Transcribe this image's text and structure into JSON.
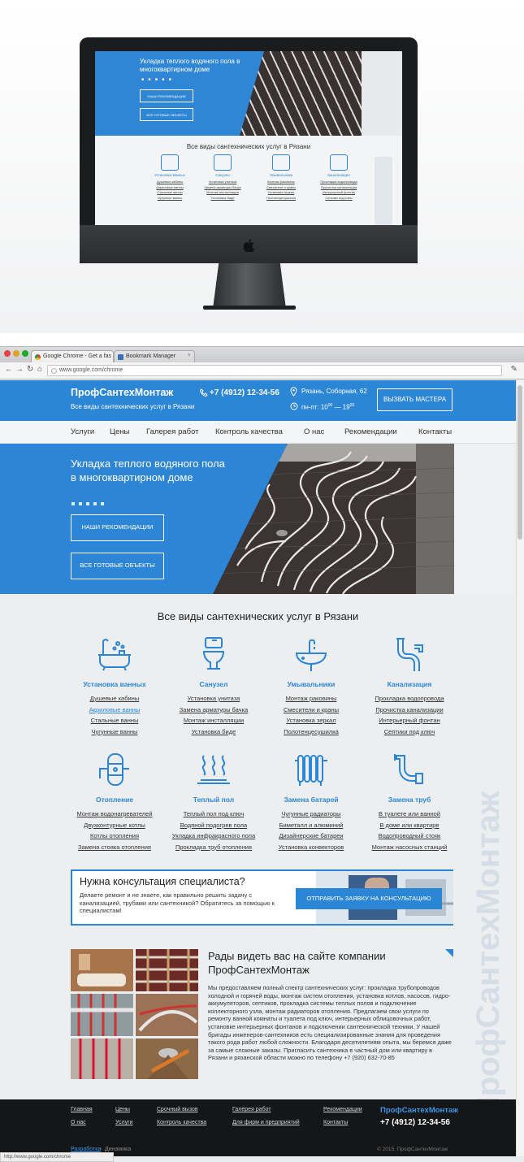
{
  "browser": {
    "tabs": [
      {
        "label": "Google Chrome - Get a fas"
      },
      {
        "label": "Bookmark Manager"
      }
    ],
    "url": "www.google.com/chrome",
    "status_url": "http://www.google.com/chrome"
  },
  "site": {
    "logo": "ПрофСантехМонтаж",
    "tagline": "Все виды сантехнических услуг в Рязани",
    "phone": "+7 (4912) 12-34-56",
    "address": "Рязань, Соборная, 62",
    "hours_prefix": "пн-пт: 10",
    "hours_sup1": "00",
    "hours_mid": " — 19",
    "hours_sup2": "00",
    "call_button": "ВЫЗВАТЬ МАСТЕРА",
    "nav": [
      "Услуги",
      "Цены",
      "Галерея работ",
      "Контроль качества",
      "О нас",
      "Рекомендации",
      "Контакты"
    ],
    "hero": {
      "title": "Укладка теплого водяного пола в многоквартирном доме",
      "button1": "НАШИ РЕКОМЕНДАЦИИ",
      "button2": "ВСЕ ГОТОВЫЕ ОБЪЕКТЫ"
    },
    "services_title": "Все виды сантехнических услуг в Рязани",
    "services": [
      {
        "name": "Установка ванных",
        "icon": "bathtub-icon",
        "links": [
          "Душевые кабины",
          "Акриловые ванны",
          "Стальные ванны",
          "Чугунные ванны"
        ]
      },
      {
        "name": "Санузел",
        "icon": "toilet-icon",
        "links": [
          "Установка унитаза",
          "Замена арматуры бачка",
          "Монтаж инсталляции",
          "Установка биде"
        ]
      },
      {
        "name": "Умывальники",
        "icon": "sink-icon",
        "links": [
          "Монтаж раковины",
          "Смесители и краны",
          "Установка зеркал",
          "Полотенцесушилка"
        ]
      },
      {
        "name": "Канализация",
        "icon": "drain-pipe-icon",
        "links": [
          "Прокладка водопровода",
          "Прочистка канализации",
          "Интерьерный фонтан",
          "Септики под ключ"
        ]
      },
      {
        "name": "Отопление",
        "icon": "boiler-icon",
        "links": [
          "Монтаж водонагревателей",
          "Двухконтурные котлы",
          "Котлы отопления",
          "Замена стояка отопления"
        ]
      },
      {
        "name": "Теплый пол",
        "icon": "heated-floor-icon",
        "links": [
          "Теплый пол под ключ",
          "Водяной подогрев пола",
          "Укладка инфракрасного пола",
          "Прокладка труб отопления"
        ]
      },
      {
        "name": "Замена батарей",
        "icon": "radiator-icon",
        "links": [
          "Чугунные радиаторы",
          "Биметалл и алюминий",
          "Дизайнерские батареи",
          "Установка конвекторов"
        ]
      },
      {
        "name": "Замена труб",
        "icon": "pipes-icon",
        "links": [
          "В туалете или ванной",
          "В доме или квартире",
          "Водопроводный стояк",
          "Монтаж насосных станций"
        ]
      }
    ],
    "watermark": "ПрофСантехМонтаж",
    "consult": {
      "title": "Нужна консультация специалиста?",
      "text": "Делаете ремонт и не знаете, как правильно решить задачу с канализацией, трубами или сантехникой? Обратитесь за помощью к специалистам!",
      "button": "ОТПРАВИТЬ ЗАЯВКУ НА КОНСУЛЬТАЦИЮ"
    },
    "about": {
      "title": "Рады видеть вас на сайте компании ПрофСантехМонтаж",
      "text": "Мы предоставляем полный спектр сантехнических услуг: прокладка трубопроводов холодной и горячей воды, монтаж систем отопления, установка котлов, насосов, гидро-аккумуляторов, септиков, прокладка системы теплых полов и подключение коллекторного узла, монтаж радиаторов отопления. Предлагаем свои услуги по ремонту ванной комнаты и туалета под ключ, интерьерных облицовочных работ, установке интерьерных фонтанов и подключении сантехнической техники. У нашей бригады инженеров-сантехников есть специализированные знания для проведения такого рода работ любой сложности. Благодаря десятилетиям опыта, мы беремся даже за самые сложные заказы. Пригласить сантехника в частный дом или квартиру в Рязани и рязанской области можно по телефону +7 (920) 632-70-85"
    },
    "footer": {
      "links": [
        "Главная",
        "О нас",
        "Цены",
        "Услуги",
        "Срочный вызов",
        "Контроль качества",
        "Галерея работ",
        "Для фирм и предприятий",
        "Рекомендации",
        "Контакты"
      ],
      "logo": "ПрофСантехМонтаж",
      "phone": "+7 (4912) 12-34-56",
      "dev_link": "Разработка",
      "dev_name": "Динамика",
      "copyright": "© 2015. ПрофСантехМонтаж"
    }
  },
  "mockup": {
    "hero_title": "Укладка теплого водяного пола в многоквартирном доме",
    "dots": "■ ■ ■ ■ ■",
    "button1": "НАШИ РЕКОМЕНДАЦИИ",
    "button2": "ВСЕ ГОТОВЫЕ ОБЪЕКТЫ",
    "services_title": "Все виды сантехнических услуг в Рязани"
  },
  "colors": {
    "accent": "#2c86d6",
    "footer_bg": "#151617",
    "page_bg": "#eceef0"
  }
}
